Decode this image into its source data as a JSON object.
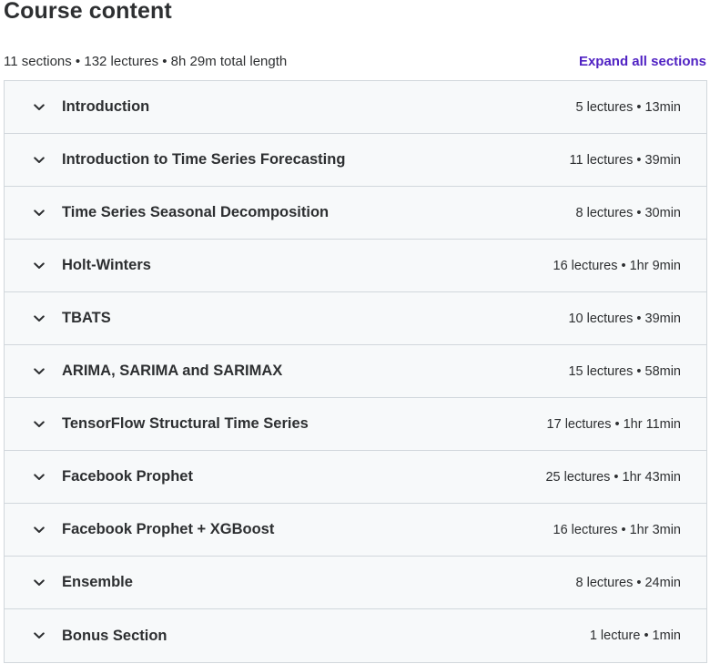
{
  "header": {
    "title": "Course content",
    "summary": "11 sections • 132 lectures • 8h 29m total length",
    "expand_label": "Expand all sections"
  },
  "sections": [
    {
      "title": "Introduction",
      "meta": "5 lectures • 13min"
    },
    {
      "title": "Introduction to Time Series Forecasting",
      "meta": "11 lectures • 39min"
    },
    {
      "title": "Time Series Seasonal Decomposition",
      "meta": "8 lectures • 30min"
    },
    {
      "title": "Holt-Winters",
      "meta": "16 lectures • 1hr 9min"
    },
    {
      "title": "TBATS",
      "meta": "10 lectures • 39min"
    },
    {
      "title": "ARIMA, SARIMA and SARIMAX",
      "meta": "15 lectures • 58min"
    },
    {
      "title": "TensorFlow Structural Time Series",
      "meta": "17 lectures • 1hr 11min"
    },
    {
      "title": "Facebook Prophet",
      "meta": "25 lectures • 1hr 43min"
    },
    {
      "title": "Facebook Prophet + XGBoost",
      "meta": "16 lectures • 1hr 3min"
    },
    {
      "title": "Ensemble",
      "meta": "8 lectures • 24min"
    },
    {
      "title": "Bonus Section",
      "meta": "1 lecture • 1min"
    }
  ],
  "icons": {
    "section_toggle": "chevron-down-icon"
  },
  "colors": {
    "text": "#2d2f31",
    "link": "#5022c3",
    "section_bg": "#f7f9fa",
    "border": "#d1d7dc"
  }
}
